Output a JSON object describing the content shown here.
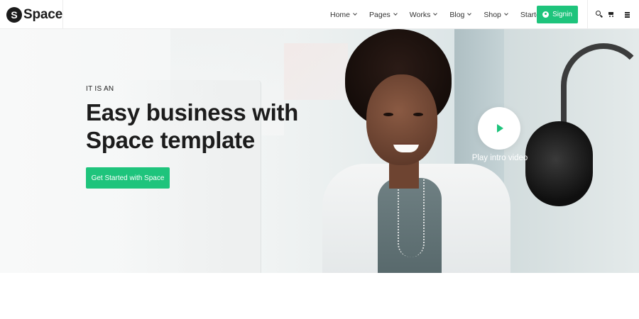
{
  "header": {
    "logo_mark": "S",
    "logo_text": "Space",
    "nav": [
      {
        "label": "Home"
      },
      {
        "label": "Pages"
      },
      {
        "label": "Works"
      },
      {
        "label": "Blog"
      },
      {
        "label": "Shop"
      },
      {
        "label": "Starter"
      }
    ],
    "signin_label": "Signin",
    "icons": [
      "search-icon",
      "cart-icon",
      "menu-icon"
    ]
  },
  "hero": {
    "tagline": "IT IS AN",
    "headline_line1": "Easy business with",
    "headline_line2": "Space template",
    "cta_label": "Get Started with Space",
    "play_label": "Play intro video"
  },
  "colors": {
    "accent": "#1ec47c",
    "text": "#1c1c1c",
    "logo": "#1b1b1b"
  }
}
